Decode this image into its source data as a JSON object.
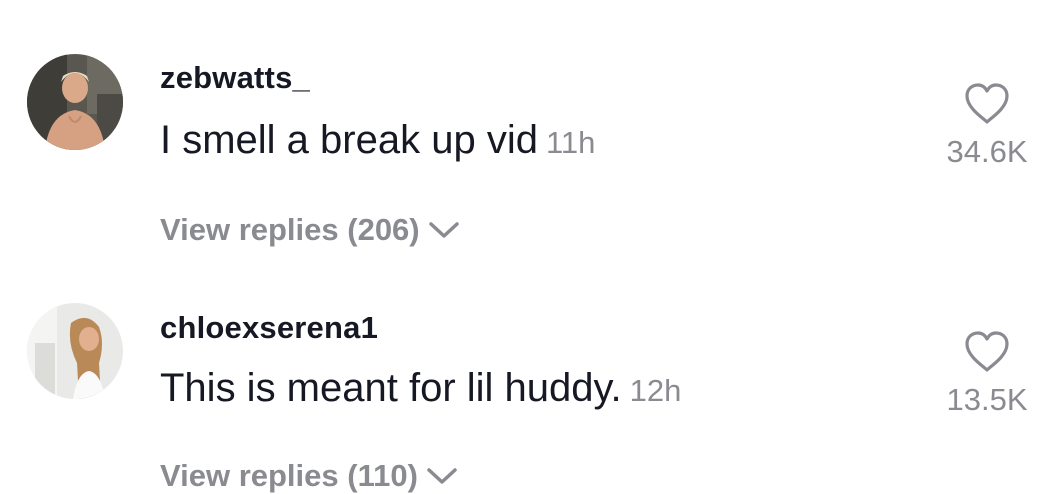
{
  "comments": [
    {
      "username": "zebwatts_",
      "text": "I smell a break up vid",
      "time": "11h",
      "likes": "34.6K",
      "replies_label": "View replies (206)",
      "avatar_icon": "user-avatar-photo"
    },
    {
      "username": "chloexserena1",
      "text": "This is meant for lil huddy.",
      "time": "12h",
      "likes": "13.5K",
      "replies_label": "View replies (110)",
      "avatar_icon": "user-avatar-photo"
    }
  ],
  "colors": {
    "primary_text": "#161823",
    "secondary_text": "#8a8b91",
    "background": "#ffffff"
  },
  "icons": {
    "like": "heart-icon",
    "expand": "chevron-down-icon"
  }
}
